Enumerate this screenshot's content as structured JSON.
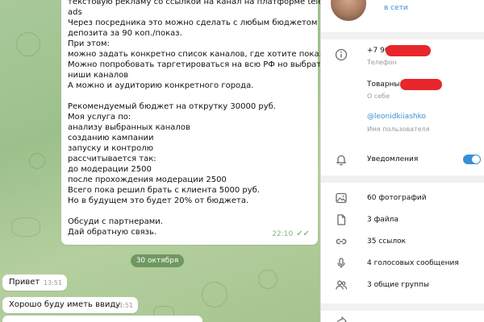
{
  "chat": {
    "long_message": {
      "lines": [
        "текстовую рекламу со ссылкой на канал на платформе telegram",
        "ads",
        "Через посредника это можно сделать с любым бюджетом без",
        "депозита  за 90 коп./показ.",
        "При этом:",
        "можно задать конкретно список каналов, где хотите показать",
        "Можно попробовать таргетироваться на всю РФ но выбрать",
        "ниши каналов",
        "А можно и аудиторию конкретного города.",
        "",
        "Рекомендуемый бюджет на открутку  30000 руб.",
        "Моя услуга по:",
        "анализу выбранных каналов",
        "созданию кампании",
        "запуску и контролю",
        "рассчитывается так:",
        "до модерации 2500",
        "после прохождения модерации 2500",
        "Всего пока решил брать с клиента 5000 руб.",
        "Но в будущем это будет 20% от бюджета.",
        "",
        "Обсуди с партнерами.",
        "Дай обратную связь."
      ],
      "time": "22:10",
      "status": "✓✓"
    },
    "date_separator": "30 октября",
    "messages": [
      {
        "text": "Привет",
        "time": "13:51"
      },
      {
        "text": "Хорошо буду иметь ввиду",
        "time": "13:51"
      }
    ]
  },
  "profile": {
    "status": "в сети",
    "phone_partial": "+7 96",
    "phone_label": "Телефон",
    "about_partial": "Товарный",
    "about_label": "О себе",
    "username": "@leonidkiiashko",
    "username_label": "Имя пользователя",
    "notifications_label": "Уведомления",
    "notifications_on": true,
    "media": [
      {
        "icon": "photo-icon",
        "label": "60 фотографий"
      },
      {
        "icon": "file-icon",
        "label": "3 файла"
      },
      {
        "icon": "link-icon",
        "label": "35 ссылок"
      },
      {
        "icon": "microphone-icon",
        "label": "4 голосовых сообщения"
      },
      {
        "icon": "users-icon",
        "label": "3 общие группы"
      }
    ]
  },
  "colors": {
    "accent": "#3a8fd6",
    "redaction": "#e8262b",
    "chat_background": "#a9c99a"
  }
}
